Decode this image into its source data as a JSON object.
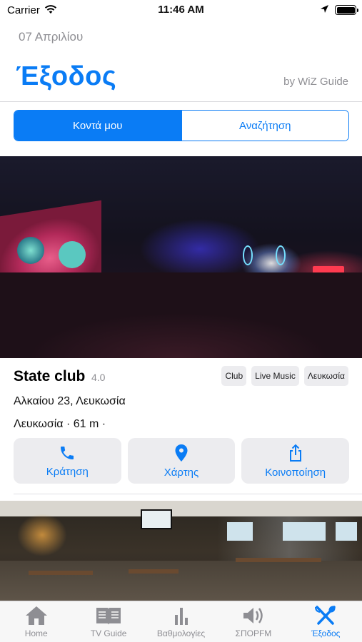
{
  "status_bar": {
    "carrier": "Carrier",
    "time": "11:46 AM"
  },
  "header": {
    "date": "07 Απριλίου",
    "title": "Έξοδος",
    "byline": "by WiZ Guide"
  },
  "segmented": {
    "options": [
      "Κοντά μου",
      "Αναζήτηση"
    ],
    "selected": "Κοντά μου"
  },
  "venues": [
    {
      "name": "State club",
      "rating": "4.0",
      "tags": [
        "Club",
        "Live Music",
        "Λευκωσία"
      ],
      "address": "Αλκαίου 23, Λευκωσία",
      "distance": "Λευκωσία · 61 m ·",
      "actions": {
        "call": "Κράτηση",
        "map": "Χάρτης",
        "share": "Κοινοποίηση"
      }
    }
  ],
  "tabbar": {
    "items": [
      {
        "label": "Home",
        "icon": "home-icon"
      },
      {
        "label": "TV Guide",
        "icon": "book-icon"
      },
      {
        "label": "Βαθμολογίες",
        "icon": "bar-chart-icon"
      },
      {
        "label": "ΣΠΟΡFM",
        "icon": "speaker-icon"
      },
      {
        "label": "Έξοδος",
        "icon": "utensils-icon"
      }
    ],
    "active": "Έξοδος"
  },
  "colors": {
    "accent": "#0a7cf5",
    "inactive": "#8e8e93"
  }
}
